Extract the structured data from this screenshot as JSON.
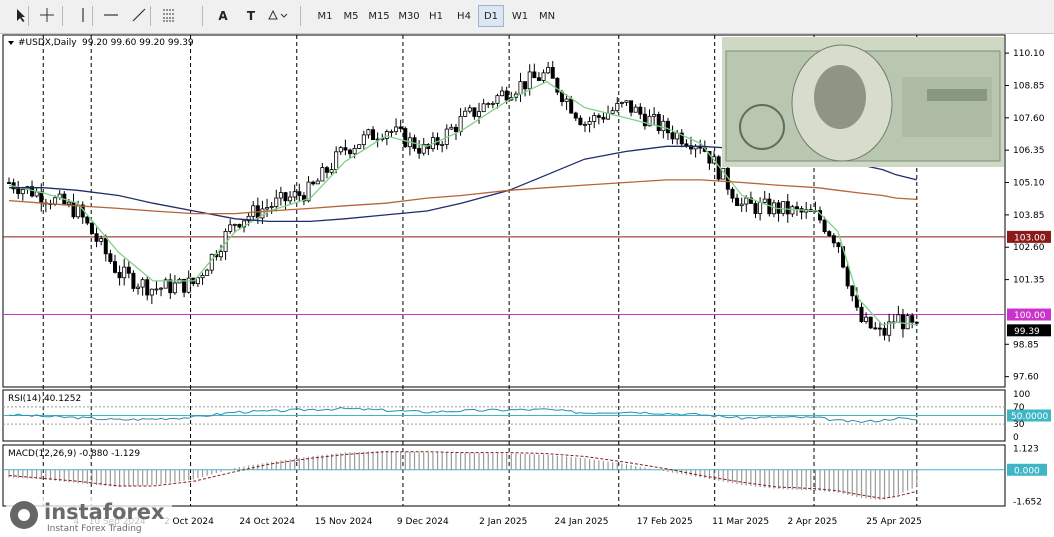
{
  "toolbar": {
    "tools": [
      {
        "icon": "cursor-arrow-icon"
      },
      {
        "icon": "crosshair-icon"
      },
      {
        "icon": "vertical-line-icon"
      },
      {
        "icon": "horizontal-line-icon"
      },
      {
        "icon": "trend-line-icon"
      },
      {
        "icon": "fibonacci-icon"
      },
      {
        "icon": "text-tool-icon",
        "label": "A"
      },
      {
        "icon": "text-label-icon",
        "label": "T"
      },
      {
        "icon": "shapes-icon"
      }
    ],
    "timeframes": [
      "M1",
      "M5",
      "M15",
      "M30",
      "H1",
      "H4",
      "D1",
      "W1",
      "MN"
    ],
    "active_timeframe": "D1"
  },
  "chart_data": [
    {
      "type": "line",
      "title": "#USDX,Daily",
      "ohlc_label": "99.20 99.60 99.20 99.39",
      "note": "candlestick price chart with moving averages; values estimated",
      "ylim": [
        97.2,
        110.8
      ],
      "y_ticks": [
        "110.10",
        "108.85",
        "107.60",
        "106.35",
        "105.10",
        "103.85",
        "102.60",
        "101.35",
        "98.85",
        "97.60"
      ],
      "x_tick_labels": [
        "4",
        "10 Sep 2024",
        "2 Oct 2024",
        "24 Oct 2024",
        "15 Nov 2024",
        "9 Dec 2024",
        "2 Jan 2025",
        "24 Jan 2025",
        "17 Feb 2025",
        "11 Mar 2025",
        "2 Apr 2025",
        "25 Apr 2025"
      ],
      "x": [
        "2024-08-09",
        "2024-08-19",
        "2024-08-29",
        "2024-09-10",
        "2024-09-20",
        "2024-10-02",
        "2024-10-14",
        "2024-10-24",
        "2024-11-05",
        "2024-11-15",
        "2024-11-27",
        "2024-12-09",
        "2024-12-19",
        "2025-01-02",
        "2025-01-13",
        "2025-01-24",
        "2025-02-05",
        "2025-02-17",
        "2025-02-27",
        "2025-03-11",
        "2025-03-21",
        "2025-04-02",
        "2025-04-08",
        "2025-04-14",
        "2025-04-21",
        "2025-04-25",
        "2025-05-01"
      ],
      "series": [
        {
          "role": "price",
          "color": "#000000",
          "values": [
            105.1,
            104.6,
            104.0,
            101.6,
            101.0,
            101.2,
            103.6,
            104.2,
            104.8,
            106.4,
            107.2,
            106.3,
            107.5,
            108.7,
            109.3,
            107.4,
            108.1,
            107.1,
            106.6,
            104.2,
            104.1,
            103.8,
            102.8,
            99.8,
            99.2,
            99.9,
            99.39
          ]
        },
        {
          "role": "ma-fast",
          "color": "#7ed28a",
          "values": [
            105.0,
            104.7,
            104.3,
            102.4,
            101.3,
            101.3,
            103.2,
            104.0,
            104.5,
            105.9,
            106.9,
            106.5,
            107.1,
            108.3,
            109.0,
            108.0,
            107.6,
            107.2,
            106.6,
            104.6,
            104.1,
            104.0,
            103.2,
            100.6,
            99.6,
            99.7,
            99.6
          ]
        },
        {
          "role": "ma-slow-navy",
          "color": "#1f2d6a",
          "values": [
            104.9,
            104.9,
            104.8,
            104.6,
            104.3,
            104.0,
            103.7,
            103.6,
            103.6,
            103.7,
            103.85,
            104.0,
            104.3,
            104.8,
            105.4,
            106.0,
            106.3,
            106.5,
            106.5,
            106.4,
            106.3,
            106.2,
            106.1,
            105.8,
            105.6,
            105.4,
            105.2
          ]
        },
        {
          "role": "ma-slow-brown",
          "color": "#b5653a",
          "values": [
            104.4,
            104.3,
            104.2,
            104.1,
            104.0,
            103.9,
            103.9,
            104.0,
            104.1,
            104.2,
            104.3,
            104.5,
            104.6,
            104.8,
            104.9,
            105.0,
            105.1,
            105.2,
            105.2,
            105.1,
            105.0,
            104.9,
            104.8,
            104.7,
            104.6,
            104.5,
            104.45
          ]
        }
      ],
      "levels": [
        {
          "value": 103.0,
          "label": "103.00",
          "color": "#8b1a1a"
        },
        {
          "value": 100.0,
          "label": "100.00",
          "color": "#cc33cc"
        },
        {
          "value": 99.39,
          "label": "99.39",
          "color": "#000000"
        }
      ]
    },
    {
      "type": "line",
      "title": "RSI(14) 40.1252",
      "ylim": [
        0,
        100
      ],
      "y_ticks": [
        "100",
        "70",
        "50.0000",
        "30",
        "0"
      ],
      "levels": [
        70,
        50,
        30
      ],
      "series": [
        {
          "color": "#2a8fb0",
          "values": [
            52,
            48,
            45,
            40,
            42,
            46,
            58,
            60,
            64,
            66,
            62,
            58,
            61,
            63,
            64,
            56,
            59,
            55,
            52,
            44,
            46,
            45,
            38,
            35,
            39,
            44,
            40.1
          ]
        }
      ]
    },
    {
      "type": "bar",
      "title": "MACD(12,26,9) -0.880 -1.129",
      "ylim": [
        -1.9,
        1.3
      ],
      "y_ticks": [
        "1.123",
        "0.000",
        "-1.652"
      ],
      "series": [
        {
          "name": "histogram",
          "color": "#9a9a9a",
          "values": [
            -0.4,
            -0.5,
            -0.7,
            -0.9,
            -0.8,
            -0.5,
            0.1,
            0.4,
            0.7,
            0.9,
            1.0,
            0.9,
            0.9,
            0.85,
            0.8,
            0.6,
            0.3,
            -0.1,
            -0.4,
            -0.8,
            -1.0,
            -1.1,
            -1.2,
            -1.45,
            -1.6,
            -1.35,
            -0.88
          ]
        },
        {
          "name": "signal",
          "color": "#8b1a1a",
          "values": [
            -0.3,
            -0.45,
            -0.6,
            -0.85,
            -0.85,
            -0.6,
            -0.1,
            0.3,
            0.6,
            0.8,
            0.95,
            0.95,
            0.9,
            0.9,
            0.85,
            0.7,
            0.4,
            0.05,
            -0.3,
            -0.65,
            -0.9,
            -1.0,
            -1.1,
            -1.3,
            -1.5,
            -1.4,
            -1.129
          ]
        }
      ]
    }
  ],
  "levels": {
    "price": {
      "l103": "103.00",
      "l100": "100.00",
      "last": "99.39"
    },
    "rsi_mid": "50.0000",
    "macd_zero": "0.000"
  },
  "logo": {
    "brand": "instaforex",
    "tagline": "Instant Forex Trading"
  }
}
